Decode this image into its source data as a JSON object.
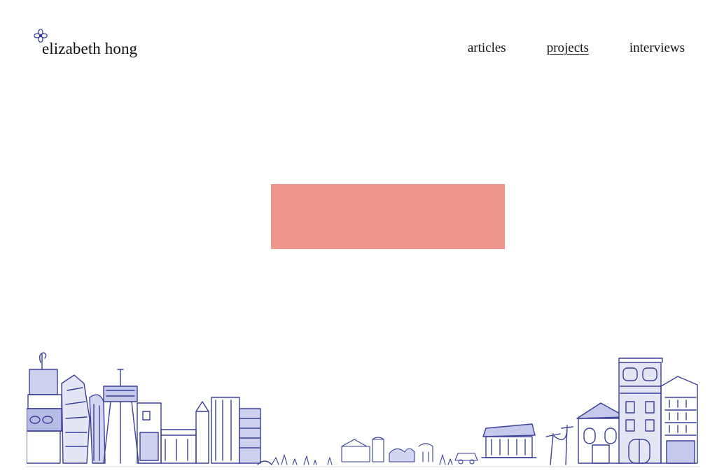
{
  "site": {
    "name": "elizabeth hong",
    "logo_icon": "flower-icon"
  },
  "nav": {
    "items": [
      {
        "label": "articles",
        "active": false
      },
      {
        "label": "projects",
        "active": true
      },
      {
        "label": "interviews",
        "active": false
      }
    ]
  },
  "hero": {
    "color": "#ee968b"
  },
  "footer": {
    "illustration": "sketched-city-skyline",
    "ink_color": "#3a3f99",
    "ground_color": "#d8d8d8"
  }
}
